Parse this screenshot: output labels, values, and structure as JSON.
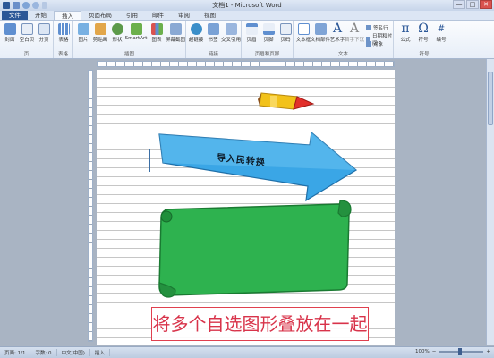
{
  "window": {
    "title": "文档1 - Microsoft Word",
    "controls": [
      "—",
      "□",
      "✕"
    ]
  },
  "tabs": [
    "文件",
    "开始",
    "插入",
    "页面布局",
    "引用",
    "邮件",
    "审阅",
    "视图"
  ],
  "active_tab": "插入",
  "ribbon": {
    "groups": [
      {
        "label": "页",
        "buttons": [
          "封面",
          "空白页",
          "分页"
        ]
      },
      {
        "label": "表格",
        "buttons": [
          "表格"
        ]
      },
      {
        "label": "插图",
        "buttons": [
          "图片",
          "剪贴画",
          "形状",
          "SmartArt",
          "图表",
          "屏幕截图"
        ]
      },
      {
        "label": "链接",
        "buttons": [
          "超链接",
          "书签",
          "交叉引用"
        ]
      },
      {
        "label": "页眉和页脚",
        "buttons": [
          "页眉",
          "页脚",
          "页码"
        ]
      },
      {
        "label": "文本",
        "buttons": [
          "文本框",
          "文档部件",
          "艺术字",
          "首字下沉"
        ],
        "small": [
          "签名行",
          "日期和时间",
          "对象"
        ]
      },
      {
        "label": "符号",
        "buttons": [
          "公式",
          "符号",
          "编号"
        ]
      }
    ]
  },
  "document": {
    "arrow_text": "导入民转换",
    "caption": "将多个自选图形叠放在一起"
  },
  "status": {
    "page": "页面: 1/1",
    "words": "字数: 0",
    "language": "中文(中国)",
    "mode": "插入",
    "zoom": "100%"
  },
  "colors": {
    "arrow_fill": "#3aa6e6",
    "scroll_fill": "#2eb24f",
    "caption_text": "#d8334a",
    "pencil_yellow": "#f2c21a",
    "pencil_red": "#e2302b"
  }
}
